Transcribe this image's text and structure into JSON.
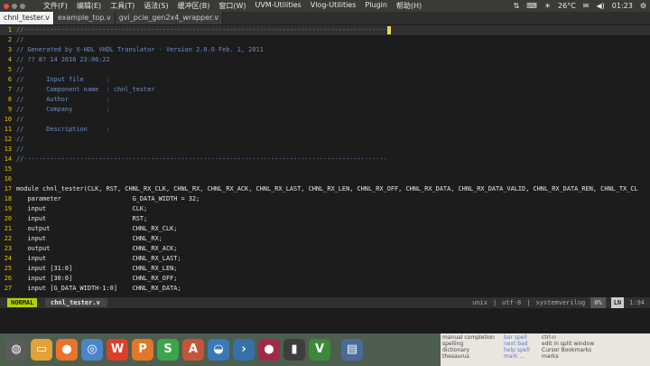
{
  "menubar": {
    "menus": [
      "文件(F)",
      "编辑(E)",
      "工具(T)",
      "语法(S)",
      "缓冲区(B)",
      "窗口(W)",
      "UVM-Utilities",
      "Vlog-Utilities",
      "Plugin",
      "帮助(H)"
    ],
    "temperature": "26°C",
    "clock": "01:23"
  },
  "tabs": [
    {
      "label": "chnl_tester.v",
      "active": true
    },
    {
      "label": "example_top.v",
      "active": false
    },
    {
      "label": "gvi_pcie_gen2x4_wrapper.v",
      "active": false
    }
  ],
  "editor": {
    "lines": [
      {
        "n": "1",
        "text": "//-------------------------------------------------------------------------------------------------",
        "cls": "comment",
        "cursor": true
      },
      {
        "n": "2",
        "text": "//",
        "cls": "comment"
      },
      {
        "n": "3",
        "text": "// Generated by X-HDL VHDL Translator - Version 2.0.0 Feb. 1, 2011",
        "cls": "comment"
      },
      {
        "n": "4",
        "text": "// ?? 8? 14 2016 23:06:22",
        "cls": "comment"
      },
      {
        "n": "5",
        "text": "//",
        "cls": "comment"
      },
      {
        "n": "6",
        "text": "//      Input file      :",
        "cls": "comment"
      },
      {
        "n": "7",
        "text": "//      Component name  : chnl_tester",
        "cls": "comment"
      },
      {
        "n": "8",
        "text": "//      Author          :",
        "cls": "comment"
      },
      {
        "n": "9",
        "text": "//      Company         :",
        "cls": "comment"
      },
      {
        "n": "10",
        "text": "//",
        "cls": "comment"
      },
      {
        "n": "11",
        "text": "//      Description     :",
        "cls": "comment"
      },
      {
        "n": "12",
        "text": "//",
        "cls": "comment"
      },
      {
        "n": "13",
        "text": "//",
        "cls": "comment"
      },
      {
        "n": "14",
        "text": "//-------------------------------------------------------------------------------------------------",
        "cls": "comment"
      },
      {
        "n": "15",
        "text": "",
        "cls": "id"
      },
      {
        "n": "16",
        "text": "",
        "cls": "id"
      },
      {
        "n": "17",
        "text": "module chnl_tester(CLK, RST, CHNL_RX_CLK, CHNL_RX, CHNL_RX_ACK, CHNL_RX_LAST, CHNL_RX_LEN, CHNL_RX_OFF, CHNL_RX_DATA, CHNL_RX_DATA_VALID, CHNL_RX_DATA_REN, CHNL_TX_CL",
        "cls": "id"
      },
      {
        "n": "18",
        "text": "   parameter                   G_DATA_WIDTH = 32;",
        "cls": "id"
      },
      {
        "n": "19",
        "text": "   input                       CLK;",
        "cls": "id"
      },
      {
        "n": "20",
        "text": "   input                       RST;",
        "cls": "id"
      },
      {
        "n": "21",
        "text": "   output                      CHNL_RX_CLK;",
        "cls": "id"
      },
      {
        "n": "22",
        "text": "   input                       CHNL_RX;",
        "cls": "id"
      },
      {
        "n": "23",
        "text": "   output                      CHNL_RX_ACK;",
        "cls": "id"
      },
      {
        "n": "24",
        "text": "   input                       CHNL_RX_LAST;",
        "cls": "id"
      },
      {
        "n": "25",
        "text": "   input [31:0]                CHNL_RX_LEN;",
        "cls": "id"
      },
      {
        "n": "26",
        "text": "   input [30:0]                CHNL_RX_OFF;",
        "cls": "id"
      },
      {
        "n": "27",
        "text": "   input [G_DATA_WIDTH-1:0]    CHNL_RX_DATA;",
        "cls": "id"
      }
    ]
  },
  "statusline": {
    "mode": "NORMAL",
    "filename": "chnl_tester.v",
    "fileformat": "unix",
    "encoding": "utf-8",
    "filetype": "systemverilog",
    "percent": "0%",
    "ln_label": "LN",
    "position": "1:94"
  },
  "dock": {
    "apps": [
      {
        "name": "ubuntu-dash-icon",
        "glyph": "◍",
        "color": "#5b5b5b"
      },
      {
        "name": "files-icon",
        "glyph": "▭",
        "color": "#e0a23a"
      },
      {
        "name": "firefox-icon",
        "glyph": "●",
        "color": "#e8732a"
      },
      {
        "name": "chromium-icon",
        "glyph": "◎",
        "color": "#4a84c9"
      },
      {
        "name": "wps-writer-icon",
        "glyph": "W",
        "color": "#d9402b"
      },
      {
        "name": "wps-presentation-icon",
        "glyph": "P",
        "color": "#e17729"
      },
      {
        "name": "wps-spreadsheet-icon",
        "glyph": "S",
        "color": "#3aa54a"
      },
      {
        "name": "software-center-icon",
        "glyph": "A",
        "color": "#c5553a"
      },
      {
        "name": "backup-icon",
        "glyph": "◒",
        "color": "#3b78b8"
      },
      {
        "name": "forward-icon",
        "glyph": "›",
        "color": "#3670a8"
      },
      {
        "name": "recorder-icon",
        "glyph": "●",
        "color": "#a02a4a"
      },
      {
        "name": "terminal-icon",
        "glyph": "▮",
        "color": "#3d3d3d"
      },
      {
        "name": "gvim-icon",
        "glyph": "V",
        "color": "#3a8a3a"
      },
      {
        "name": "system-monitor-icon",
        "glyph": "▤",
        "color": "#4a6a9a"
      }
    ],
    "side_panel": {
      "col1": [
        "manual completion",
        "spelling",
        "dictionary",
        "thesaurus"
      ],
      "col2": [
        "bar spell",
        "next bad",
        "help spell",
        "mark ..."
      ],
      "col3": [
        "ctrl-n",
        "edit in split window",
        "Cursor Bookmarks",
        "marks"
      ]
    }
  }
}
